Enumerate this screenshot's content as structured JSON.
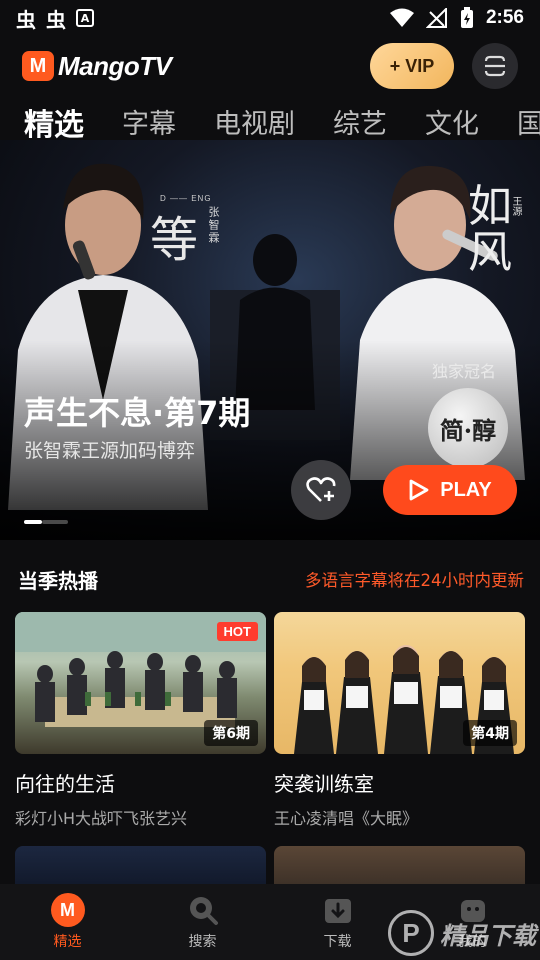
{
  "status_bar": {
    "left_glyphs": [
      "虫",
      "虫"
    ],
    "app_badge": "A",
    "time": "2:56"
  },
  "header": {
    "logo_mark": "M",
    "logo_text": "MangoTV",
    "vip_label": "+ VIP"
  },
  "tabs": [
    {
      "label": "精选",
      "active": true
    },
    {
      "label": "字幕"
    },
    {
      "label": "电视剧"
    },
    {
      "label": "综艺"
    },
    {
      "label": "文化"
    },
    {
      "label": "国"
    }
  ],
  "hero": {
    "title": "声生不息·第7期",
    "subtitle": "张智霖王源加码博弈",
    "calligraphy_left": "等",
    "calligraphy_left_names": "张智霖",
    "calligraphy_left_tag": "D —— ENG",
    "calligraphy_right": "如风",
    "calligraphy_right_names": "王源",
    "sponsor_label": "独家冠名",
    "sponsor_badge": "简·醇",
    "play_label": "PLAY",
    "carousel": {
      "current": 1
    }
  },
  "section": {
    "title": "当季热播",
    "note": "多语言字幕将在24小时内更新"
  },
  "cards": [
    {
      "title": "向往的生活",
      "desc": "彩灯小H大战吓飞张艺兴",
      "badge": "HOT",
      "episode": "第6期"
    },
    {
      "title": "突袭训练室",
      "desc": "王心凌清唱《大眠》",
      "episode": "第4期"
    }
  ],
  "bottom_nav": [
    {
      "label": "精选",
      "icon": "mango-home-icon",
      "active": true
    },
    {
      "label": "搜索",
      "icon": "search-icon"
    },
    {
      "label": "下载",
      "icon": "download-icon"
    },
    {
      "label": "我的",
      "icon": "profile-icon"
    }
  ],
  "watermark": {
    "mark": "P",
    "text": "精品下载"
  },
  "colors": {
    "accent": "#ff4a1c",
    "vip_gold": "#f2b65d",
    "background": "#0d0d0f"
  }
}
